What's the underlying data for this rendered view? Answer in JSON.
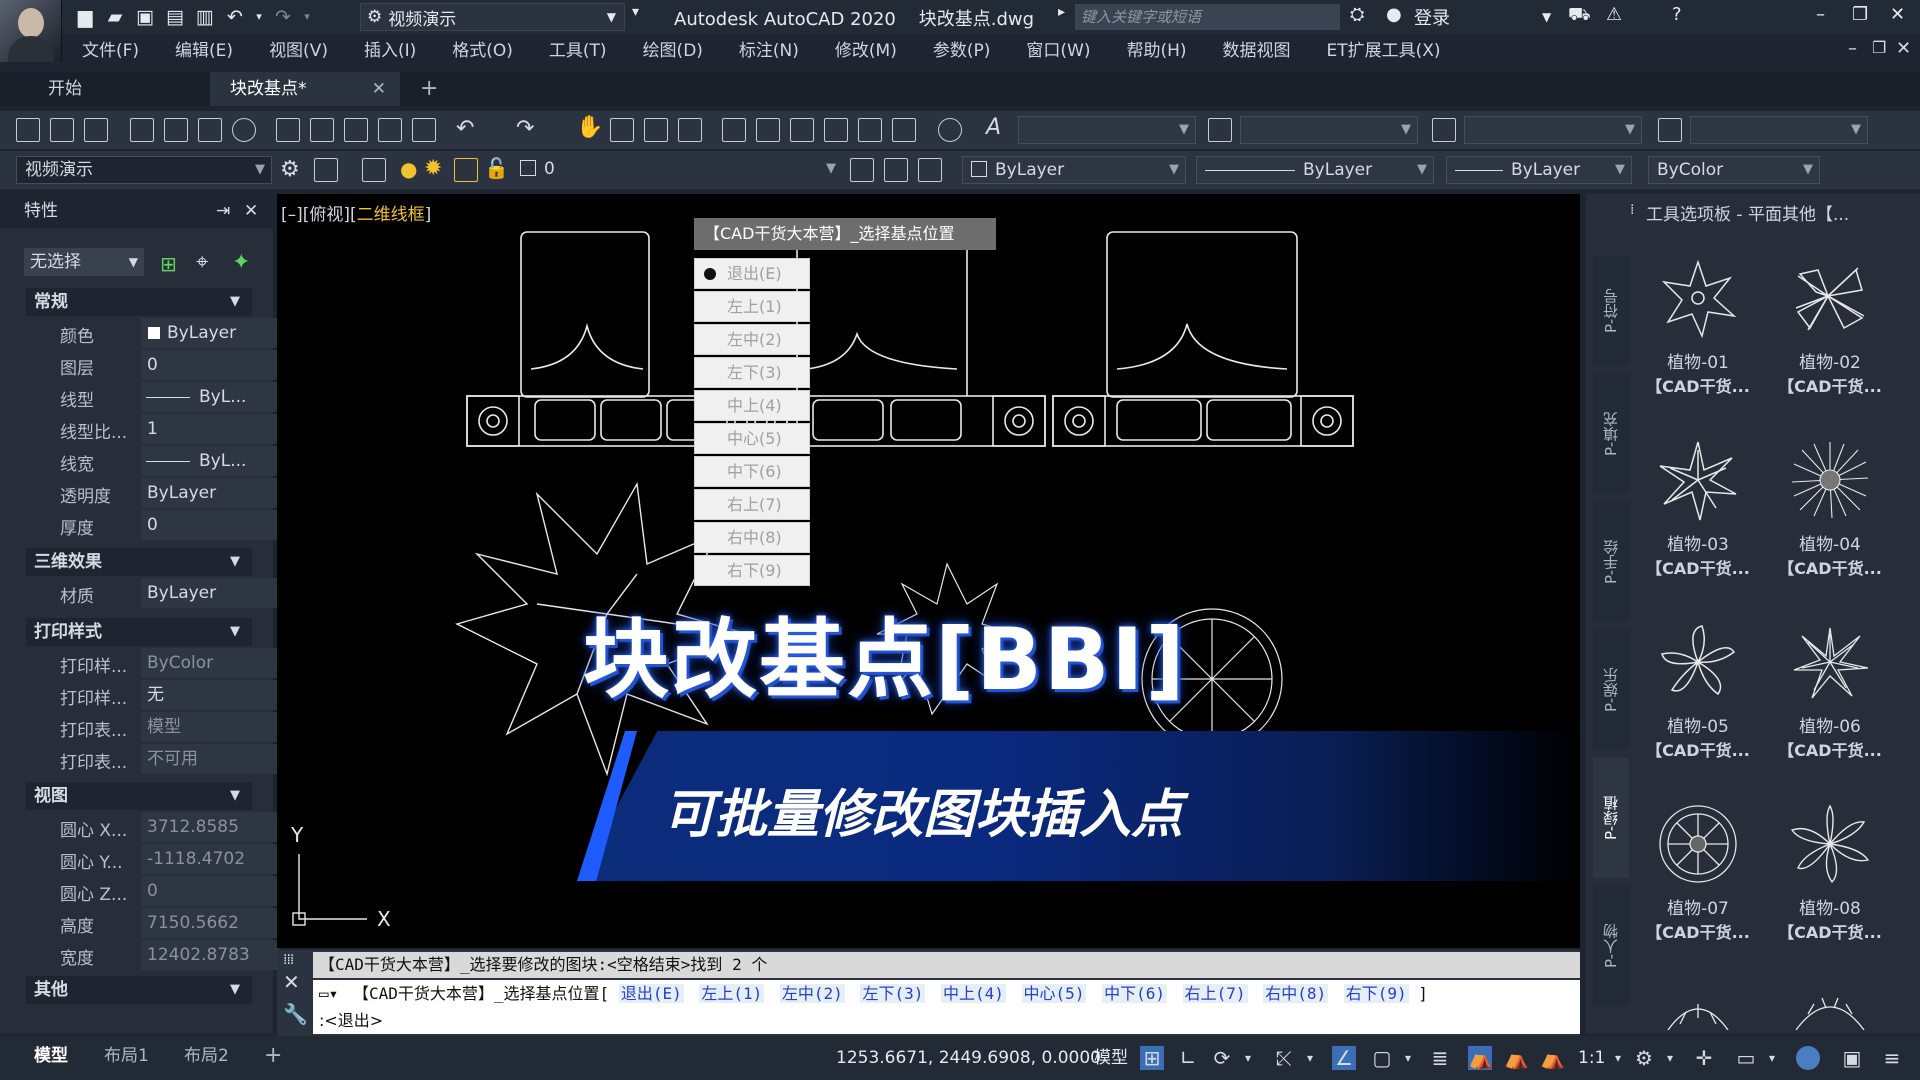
{
  "title": {
    "workspace": "视频演示",
    "app_title": "Autodesk AutoCAD 2020",
    "file_name": "块改基点.dwg",
    "search_placeholder": "键入关键字或短语",
    "login": "登录"
  },
  "menu": [
    "文件(F)",
    "编辑(E)",
    "视图(V)",
    "插入(I)",
    "格式(O)",
    "工具(T)",
    "绘图(D)",
    "标注(N)",
    "修改(M)",
    "参数(P)",
    "窗口(W)",
    "帮助(H)",
    "数据视图",
    "ET扩展工具(X)"
  ],
  "tabs": {
    "start": "开始",
    "doc": "块改基点*"
  },
  "toolbar2": {
    "workspace": "视频演示",
    "layer": "0",
    "color": "ByLayer",
    "linetype": "ByLayer",
    "lineweight": "ByLayer",
    "plotstyle": "ByColor"
  },
  "properties": {
    "header": "特性",
    "selection": "无选择",
    "sections": {
      "general": "常规",
      "effects3d": "三维效果",
      "plot": "打印样式",
      "view": "视图",
      "misc": "其他"
    },
    "general": [
      {
        "k": "颜色",
        "v": "ByLayer"
      },
      {
        "k": "图层",
        "v": "0"
      },
      {
        "k": "线型",
        "v": "ByL..."
      },
      {
        "k": "线型比...",
        "v": "1"
      },
      {
        "k": "线宽",
        "v": "ByL..."
      },
      {
        "k": "透明度",
        "v": "ByLayer"
      },
      {
        "k": "厚度",
        "v": "0"
      }
    ],
    "effects3d": [
      {
        "k": "材质",
        "v": "ByLayer"
      }
    ],
    "plot": [
      {
        "k": "打印样...",
        "v": "ByColor"
      },
      {
        "k": "打印样...",
        "v": "无"
      },
      {
        "k": "打印表...",
        "v": "模型"
      },
      {
        "k": "打印表...",
        "v": "不可用"
      }
    ],
    "view": [
      {
        "k": "圆心 X...",
        "v": "3712.8585"
      },
      {
        "k": "圆心 Y...",
        "v": "-1118.4702"
      },
      {
        "k": "圆心 Z...",
        "v": "0"
      },
      {
        "k": "高度",
        "v": "7150.5662"
      },
      {
        "k": "宽度",
        "v": "12402.8783"
      }
    ]
  },
  "viewport": {
    "label_prefix": "[–][俯视][",
    "label_style": "二维线框",
    "label_suffix": "]"
  },
  "context_menu": {
    "title": "【CAD干货大本营】_选择基点位置",
    "items": [
      "退出(E)",
      "左上(1)",
      "左中(2)",
      "左下(3)",
      "中上(4)",
      "中心(5)",
      "中下(6)",
      "右上(7)",
      "右中(8)",
      "右下(9)"
    ]
  },
  "overlay": {
    "title": "块改基点[BBI]",
    "subtitle": "可批量修改图块插入点"
  },
  "command": {
    "history": "【CAD干货大本营】_选择要修改的图块:<空格结束>找到 2 个",
    "prompt_prefix": "【CAD干货大本营】_选择基点位置[",
    "options": [
      "退出(E)",
      "左上(1)",
      "左中(2)",
      "左下(3)",
      "中上(4)",
      "中心(5)",
      "中下(6)",
      "右上(7)",
      "右中(8)",
      "右下(9)"
    ],
    "prompt_suffix": "]",
    "input": ":<退出>"
  },
  "palette": {
    "title": "工具选项板 - 平面其他【...",
    "vtabs": [
      "P-符号",
      "P-填充",
      "P-手绘",
      "P-娱乐",
      "P-绿植",
      "P-人物"
    ],
    "tools": [
      {
        "n": "植物-01",
        "s": "【CAD干货..."
      },
      {
        "n": "植物-02",
        "s": "【CAD干货..."
      },
      {
        "n": "植物-03",
        "s": "【CAD干货..."
      },
      {
        "n": "植物-04",
        "s": "【CAD干货..."
      },
      {
        "n": "植物-05",
        "s": "【CAD干货..."
      },
      {
        "n": "植物-06",
        "s": "【CAD干货..."
      },
      {
        "n": "植物-07",
        "s": "【CAD干货..."
      },
      {
        "n": "植物-08",
        "s": "【CAD干货..."
      }
    ]
  },
  "status": {
    "layout_tabs": [
      "模型",
      "布局1",
      "布局2"
    ],
    "coords": "1253.6671, 2449.6908, 0.0000",
    "model": "模型",
    "scale": "1:1"
  }
}
